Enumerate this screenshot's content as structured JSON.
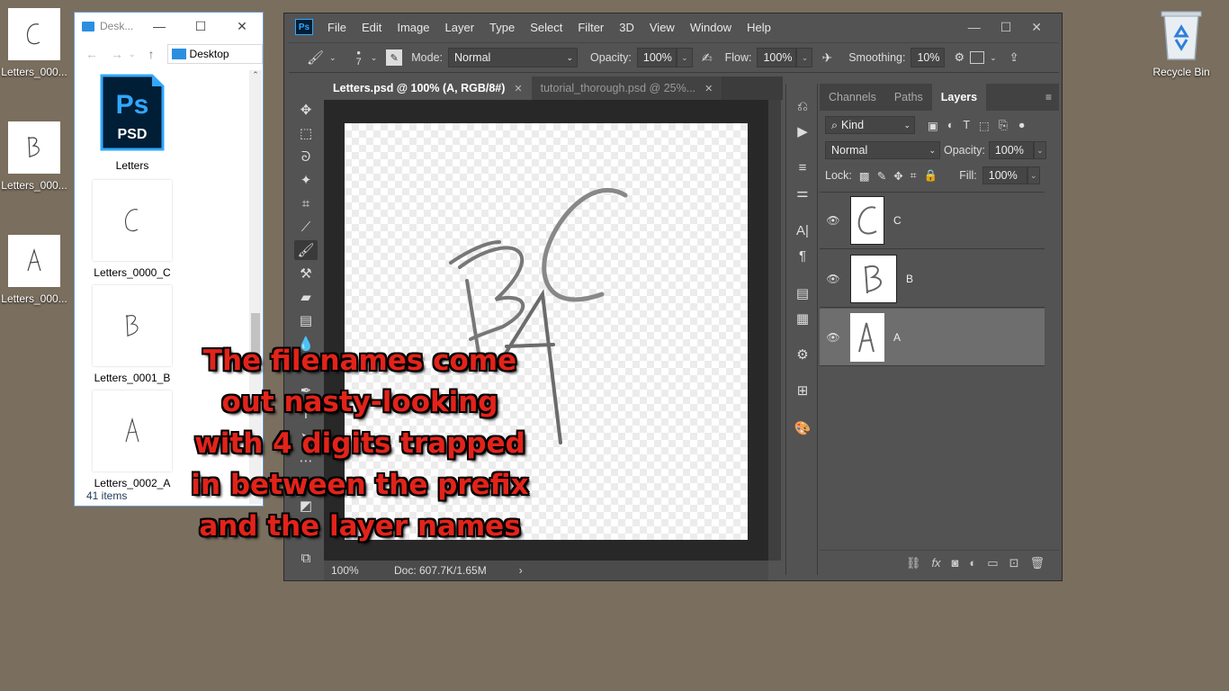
{
  "desktop": {
    "icons": [
      {
        "label": "Letters_000...",
        "letter": "C"
      },
      {
        "label": "Letters_000...",
        "letter": "B"
      },
      {
        "label": "Letters_000...",
        "letter": "A"
      }
    ],
    "recycle_bin": "Recycle Bin"
  },
  "explorer": {
    "title": "Desk...",
    "address": "Desktop",
    "items": [
      {
        "label": "Letters",
        "type": "psd",
        "badge": "PSD",
        "logo": "Ps"
      },
      {
        "label": "Letters_0000_C",
        "letter": "C"
      },
      {
        "label": "Letters_0001_B",
        "letter": "B"
      },
      {
        "label": "Letters_0002_A",
        "letter": "A"
      }
    ],
    "status": "41 items"
  },
  "photoshop": {
    "logo": "Ps",
    "menu": [
      "File",
      "Edit",
      "Image",
      "Layer",
      "Type",
      "Select",
      "Filter",
      "3D",
      "View",
      "Window",
      "Help"
    ],
    "options": {
      "brush_size": "7",
      "mode_label": "Mode:",
      "mode_value": "Normal",
      "opacity_label": "Opacity:",
      "opacity_value": "100%",
      "flow_label": "Flow:",
      "flow_value": "100%",
      "smoothing_label": "Smoothing:",
      "smoothing_value": "10%"
    },
    "tabs": [
      {
        "label": "Letters.psd @ 100% (A, RGB/8#)",
        "active": true
      },
      {
        "label": "tutorial_thorough.psd @ 25%...",
        "active": false
      }
    ],
    "status": {
      "zoom": "100%",
      "doc": "Doc: 607.7K/1.65M"
    },
    "layers_panel": {
      "tabs": [
        "Channels",
        "Paths",
        "Layers"
      ],
      "filter_kind": "Kind",
      "blend_mode": "Normal",
      "opacity_label": "Opacity:",
      "opacity_value": "100%",
      "lock_label": "Lock:",
      "fill_label": "Fill:",
      "fill_value": "100%",
      "layers": [
        {
          "name": "C",
          "selected": false
        },
        {
          "name": "B",
          "selected": false
        },
        {
          "name": "A",
          "selected": true
        }
      ]
    }
  },
  "caption": {
    "lines": [
      "The filenames come",
      "out nasty-looking",
      "with 4 digits trapped",
      "in between the prefix",
      "and the layer names"
    ]
  }
}
